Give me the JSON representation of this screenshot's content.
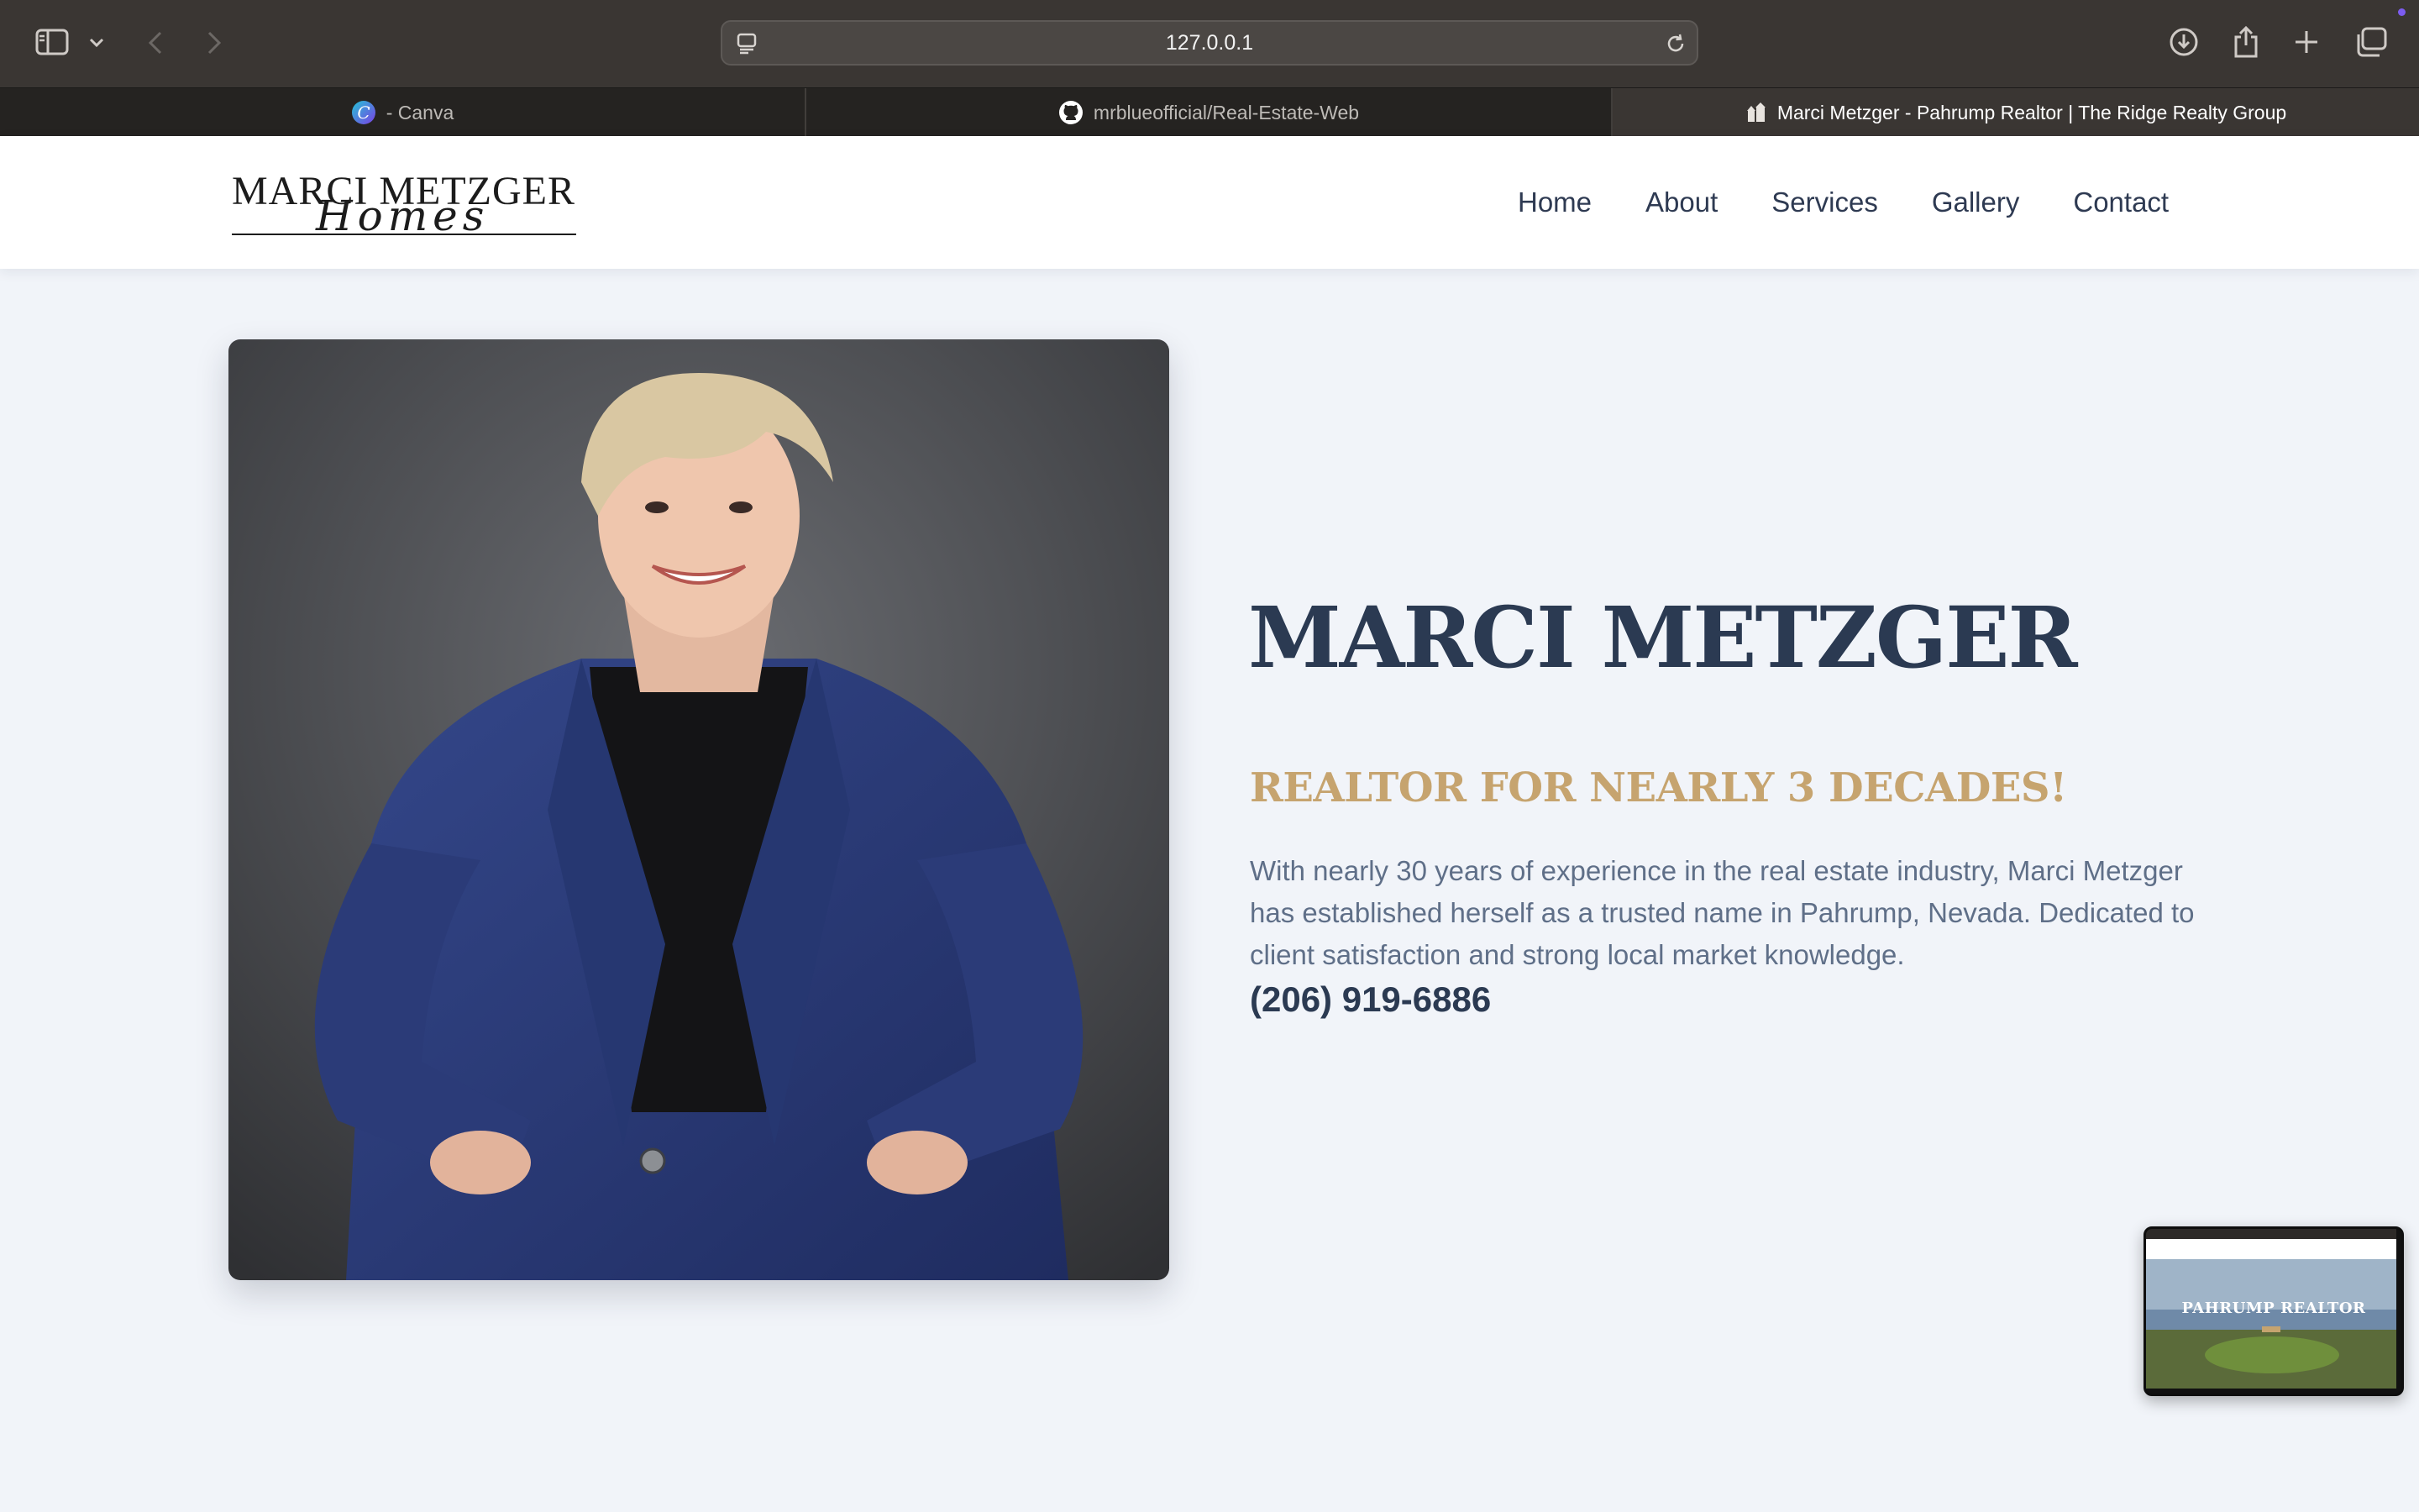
{
  "browser": {
    "url": "127.0.0.1",
    "tabs": [
      {
        "label": "- Canva",
        "icon": "canva-icon"
      },
      {
        "label": "mrblueofficial/Real-Estate-Web",
        "icon": "github-icon"
      },
      {
        "label": "Marci Metzger - Pahrump Realtor | The Ridge Realty Group",
        "icon": "site-favicon",
        "active": true
      }
    ]
  },
  "site": {
    "logo": {
      "main": "MARCI METZGER",
      "script": "Homes"
    },
    "nav": [
      "Home",
      "About",
      "Services",
      "Gallery",
      "Contact"
    ]
  },
  "hero": {
    "name": "MARCI METZGER",
    "tagline": "REALTOR FOR NEARLY 3 DECADES!",
    "bio": "With nearly 30 years of experience in the real estate industry, Marci Metzger has established herself as a trusted name in Pahrump, Nevada. Dedicated to client satisfaction and strong local market knowledge.",
    "phone": "(206) 919-6886"
  },
  "thumbnail": {
    "label": "PAHRUMP REALTOR"
  },
  "colors": {
    "page_bg": "#f1f4f9",
    "heading": "#2b3a52",
    "accent_gold": "#c6a46f",
    "body_text": "#5f6f88",
    "chrome_bg": "#3a3633"
  }
}
